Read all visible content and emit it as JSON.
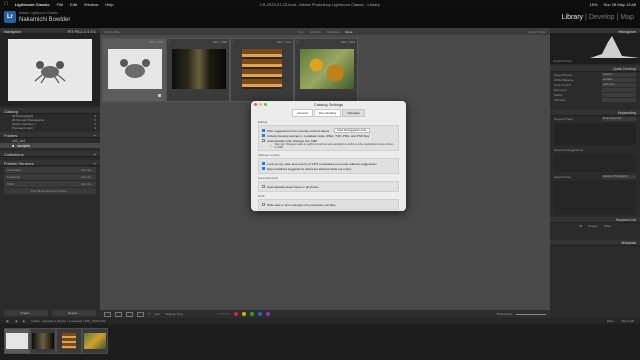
{
  "menubar": {
    "app": "Lightroom Classic",
    "items": [
      "File",
      "Edit",
      "Window",
      "Help"
    ],
    "window_title": "LR-2023-07-23.lrcat - Adobe Photoshop Lightroom Classic - Library",
    "battery": "15%",
    "clock": "Sun 28 May 13:48"
  },
  "identity": {
    "sub": "Adobe Lightroom Classic",
    "name": "Nakamichi Bowlder",
    "logo": "Lr"
  },
  "modules": {
    "library": "Library",
    "develop": "Develop",
    "map": "Map",
    "sep": "|"
  },
  "left": {
    "navigator": "Navigator",
    "fit": "FIT  FILL  1:1  3:1",
    "catalog": "Catalog",
    "catalog_items": [
      {
        "label": "All Photographs",
        "count": "4"
      },
      {
        "label": "All Synced Photographs",
        "count": "0"
      },
      {
        "label": "Quick Collection +",
        "count": "0"
      },
      {
        "label": "Previous Import",
        "count": "4"
      }
    ],
    "folders": "Folders",
    "volume": "sd3_ssd",
    "folder": "samples",
    "collections": "Collections",
    "publish": "Publish Services",
    "services": [
      {
        "label": "Hard Drive",
        "action": "Set Up..."
      },
      {
        "label": "Facebook",
        "action": "Set Up..."
      },
      {
        "label": "Flickr",
        "action": "Set Up..."
      },
      {
        "label": "Find More Services Online...",
        "action": ""
      }
    ],
    "import": "Import...",
    "export": "Export..."
  },
  "grid": {
    "filter": "Library Filter :",
    "filter_opts": [
      "Text",
      "Attribute",
      "Metadata",
      "None"
    ],
    "filter_active": "None",
    "custom": "Custom Filter",
    "cells": [
      {
        "big": "1",
        "num": "IMG_7949"
      },
      {
        "big": "2",
        "num": "IMG_7958"
      },
      {
        "big": "3",
        "num": "IMG_7913"
      },
      {
        "big": "4",
        "num": "IMG_7905"
      }
    ]
  },
  "toolbar": {
    "sort": "Sort:",
    "sort_value": "Capture Time",
    "thumbnails": "Thumbnails"
  },
  "right": {
    "histogram": "Histogram",
    "original": "Original Photo",
    "quick_develop": "Quick Develop",
    "rows": [
      {
        "label": "Saved Preset",
        "value": "Custom"
      },
      {
        "label": "White Balance",
        "value": "As Shot"
      },
      {
        "label": "Tone Control",
        "value": "Auto Tone"
      },
      {
        "label": "Exposure",
        "value": ""
      },
      {
        "label": "Clarity",
        "value": ""
      },
      {
        "label": "Vibrance",
        "value": ""
      }
    ],
    "keywording": "Keywording",
    "keyword_tags": "Keyword Tags",
    "keyword_value": "Enter Keywords",
    "suggestions": "Keyword Suggestions",
    "keyword_set": "Keyword Set",
    "keyword_set_value": "Outdoor Photography",
    "keyword_list": "Keyword List",
    "all_label": "All",
    "people_label": "People",
    "other_label": "Other",
    "metadata": "Metadata",
    "sync": "Sync Metadata",
    "sync_settings": "Sync Settings"
  },
  "filmstrip": {
    "path": "Folder : samples   4 photos / 1 selected / IMG_7949.CR2",
    "filter": "Filter :",
    "filter_value": "Filters Off"
  },
  "dialog": {
    "title": "Catalog Settings",
    "tabs": [
      "General",
      "File Handling",
      "Metadata"
    ],
    "active_tab": "Metadata",
    "editing_label": "Editing",
    "editing": [
      {
        "label": "Offer suggestions from recently entered values",
        "checked": true,
        "extra": "Clear All Suggestion Lists"
      },
      {
        "label": "Include Develop settings in metadata inside JPEG, TIFF, PNG, and PSD files",
        "checked": true,
        "extra": ""
      },
      {
        "label": "Automatically write changes into XMP",
        "checked": false,
        "extra": ""
      }
    ],
    "warning": "Warning: Changes made in Lightroom will not automatically be visible in other applications when written to XMP",
    "address_label": "Address Lookup",
    "address": [
      {
        "label": "Look up city, state and country of GPS coordinates to provide address suggestions",
        "checked": true
      },
      {
        "label": "Export address suggestions whenever address fields are empty",
        "checked": true
      }
    ],
    "face_label": "Face Detection",
    "face": [
      {
        "label": "Automatically detect faces in all photos",
        "checked": false
      }
    ],
    "exif_label": "EXIF",
    "exif": [
      {
        "label": "Write date or time changes into proprietary raw files",
        "checked": false
      }
    ]
  },
  "colors": {
    "accent": "#2e7bd8",
    "panel": "#2b2b2b",
    "grid": "#4a4a4a"
  }
}
